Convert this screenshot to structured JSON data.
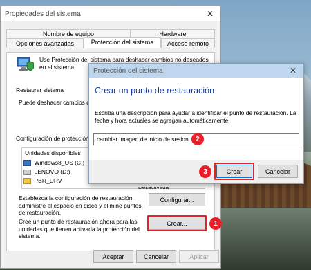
{
  "main": {
    "title": "Propiedades del sistema",
    "tabs_row1": [
      "Nombre de equipo",
      "Hardware"
    ],
    "tabs_row2": [
      "Opciones avanzadas",
      "Protección del sistema",
      "Acceso remoto"
    ],
    "intro": "Use Protección del sistema para deshacer cambios no deseados en el sistema.",
    "restore_heading": "Restaurar sistema",
    "restore_text": "Puede deshacer cambios del sistema revirtiendo el equipo a un punto de restauración anterior.",
    "config_heading": "Configuración de protección",
    "drives_header": "Unidades disponibles",
    "drives": [
      "Windows8_OS (C:) (Sistema)",
      "LENOVO (D:)",
      "PBR_DRV"
    ],
    "drives_protection_partial": "Desactivada",
    "config_text": "Establezca la configuración de restauración, administre el espacio en disco y elimine puntos de restauración.",
    "config_button": "Configurar...",
    "create_text": "Cree un punto de restauración ahora para las unidades que tienen activada la protección del sistema.",
    "create_button": "Crear...",
    "ok_button": "Aceptar",
    "cancel_button": "Cancelar",
    "apply_button": "Aplicar"
  },
  "dialog": {
    "title": "Protección del sistema",
    "heading": "Crear un punto de restauración",
    "description": "Escriba una descripción para ayudar a identificar el punto de restauración. La fecha y hora actuales se agregan automáticamente.",
    "input_value": "cambiar imagen de inicio de sesion",
    "create_button": "Crear",
    "cancel_button": "Cancelar"
  },
  "badges": [
    "1",
    "2",
    "3"
  ],
  "colors": {
    "accent_red": "#e8202a",
    "dialog_title_bg": "#bfd7ee",
    "heading_blue": "#1e3f9c"
  }
}
